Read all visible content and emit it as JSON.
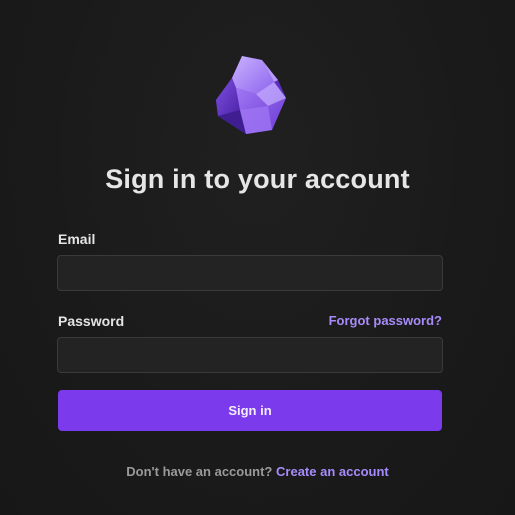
{
  "app": {
    "logo_icon": "obsidian-crystal-logo-icon",
    "accent_color": "#7c3aed",
    "link_color": "#a88bfa"
  },
  "login": {
    "title": "Sign in to your account",
    "email_label": "Email",
    "email_value": "",
    "password_label": "Password",
    "password_value": "",
    "forgot_password": "Forgot password?",
    "submit_label": "Sign in",
    "no_account_text": "Don't have an account?",
    "create_account_link": "Create an account"
  }
}
